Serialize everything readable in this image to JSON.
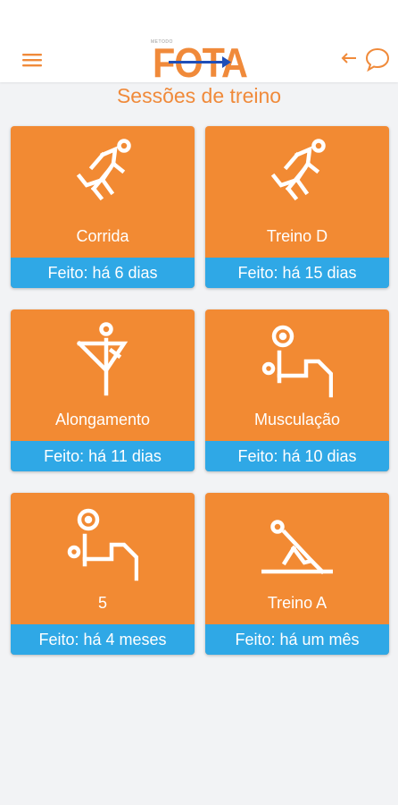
{
  "header": {
    "logo_text": "FOTA",
    "logo_small": "METODO",
    "menu_icon": "hamburger-menu-icon",
    "back_icon": "arrow-left-icon",
    "chat_icon": "chat-bubble-icon"
  },
  "page_title": "Sessões de treino",
  "colors": {
    "accent": "#f08a3a",
    "card_bg": "#f28a33",
    "status_bg": "#2fa8e6",
    "logo_blue": "#1f4fb8"
  },
  "sessions": [
    {
      "label": "Corrida",
      "status": "Feito: há 6 dias",
      "icon": "runner-icon"
    },
    {
      "label": "Treino D",
      "status": "Feito: há 15 dias",
      "icon": "runner-icon"
    },
    {
      "label": "Alongamento",
      "status": "Feito: há 11 dias",
      "icon": "stretching-icon"
    },
    {
      "label": "Musculação",
      "status": "Feito: há 10 dias",
      "icon": "weightlifting-icon"
    },
    {
      "label": "5",
      "status": "Feito: há 4 meses",
      "icon": "weightlifting-icon"
    },
    {
      "label": "Treino A",
      "status": "Feito: há um mês",
      "icon": "floor-exercise-icon"
    }
  ]
}
